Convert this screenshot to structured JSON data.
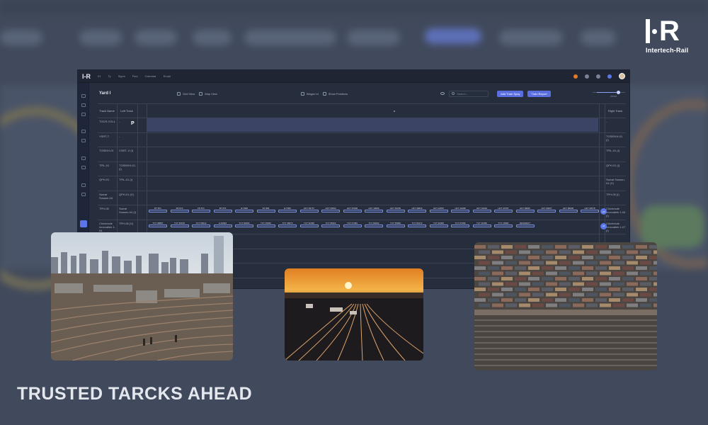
{
  "brand": {
    "logo_mark": "I-R",
    "logo_text": "Intertech-Rail"
  },
  "app": {
    "brand": "I-R",
    "nav": [
      "01",
      "Ty",
      "Signs",
      "Find",
      "Calendar",
      "Email"
    ],
    "toolbar": {
      "title": "Yard I",
      "grid_view": "Grid View",
      "map_view": "Map View",
      "wagon_id": "Wagon Id",
      "show_positions": "Show Positions",
      "search_placeholder": "Search...",
      "add_train_btn": "Add Train Spay",
      "train_report_btn": "Train Report",
      "zoom_label": "ZOOM"
    },
    "grid": {
      "header": {
        "track_name": "Track Name",
        "left_track": "Left Track",
        "right_track": "Right Track",
        "center_marker": "•"
      },
      "p_badge": "P",
      "rows": [
        {
          "name": "TGCR-YGL1",
          "left": "-",
          "right": "-"
        },
        {
          "name": "YSRT-T",
          "left": "-",
          "right": "TGSIEKH-01 (I)"
        },
        {
          "name": "TGSIKH-01",
          "left": "CSRT- 0 (I)",
          "right": "TPIL-01 (I)"
        },
        {
          "name": "TPIL-01",
          "left": "TGSIEKH-01 (I)",
          "right": "QPH-01 (I)"
        },
        {
          "name": "QPH-01",
          "left": "TPIL-01 (I)",
          "right": "Sweat Sussen-04 (V)"
        },
        {
          "name": "Sweat Sussen-04",
          "left": "QPH-01 (V)",
          "right": "TPH-05 (I)"
        },
        {
          "name": "TPH-05",
          "left": "Sweat Sussen-04 (I)",
          "right": "Chichesde Innovatiek 1-04 (I)"
        },
        {
          "name": "Chichesde Innovatiek 1-04",
          "left": "TPH-05 (V)",
          "right": "Chichesde Innovatiek 1-07 (I)"
        }
      ],
      "row7_cars": [
        "RT 871",
        "RF 872",
        "FP 871",
        "BT 876",
        "ET 868",
        "RT 866",
        "ET 865",
        "HKT 53767",
        "HKT 53952",
        "HKT 87996",
        "HKT 19956",
        "HKT 45256",
        "HKT 90834",
        "HKT 42897",
        "HKT 40188",
        "HKT 91094",
        "HKT 63787",
        "HKT 99897",
        "HKT 69607",
        "HKT 98009",
        "HKT 34578"
      ],
      "row7_count": "+12",
      "row8_cars": [
        "TCT 98857",
        "TCT 96978",
        "TCT 59612",
        "A 26994",
        "TCT 84893",
        "TCT 45952",
        "TCT 45873",
        "TCT 52395",
        "TCT 65963",
        "TCT 67083",
        "TCT 80062",
        "TCT 55890",
        "TCT 82472",
        "TCT 92083",
        "TCT 87489",
        "TCT 36456",
        "TCT 16982",
        "RESIDENT"
      ],
      "row8_count": "+8"
    }
  },
  "photos": [
    {
      "name": "rail yard with city skyline"
    },
    {
      "name": "rail tracks at sunset"
    },
    {
      "name": "aerial rail yard with freight cars"
    }
  ],
  "tagline": "TRUSTED TARCKS AHEAD",
  "colors": {
    "background": "#414a5c",
    "accent": "#5b6ee0",
    "panel": "#262d3d"
  }
}
